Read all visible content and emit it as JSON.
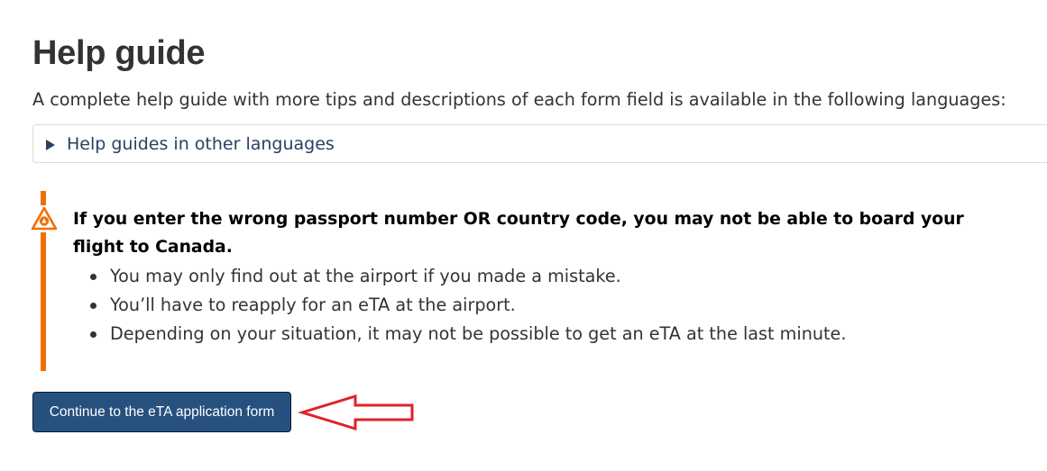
{
  "header": {
    "title": "Help guide"
  },
  "intro": {
    "text": "A complete help guide with more tips and descriptions of each form field is available in the following languages:"
  },
  "help_guides": {
    "summary_label": "Help guides in other languages",
    "expanded": false,
    "icon": "triangle-right"
  },
  "warning": {
    "icon": "warning-triangle-icon",
    "accent_color": "#ee7100",
    "heading": "If you enter the wrong passport number OR country code, you may not be able to board your flight to Canada.",
    "items": [
      "You may only find out at the airport if you made a mistake.",
      "You’ll have to reapply for an eTA at the airport.",
      "Depending on your situation, it may not be possible to get an eTA at the last minute."
    ]
  },
  "actions": {
    "continue_label": "Continue to the eTA application form",
    "continue_color": "#26507e"
  },
  "annotation": {
    "type": "arrow",
    "direction": "left",
    "color": "#e0222a"
  }
}
